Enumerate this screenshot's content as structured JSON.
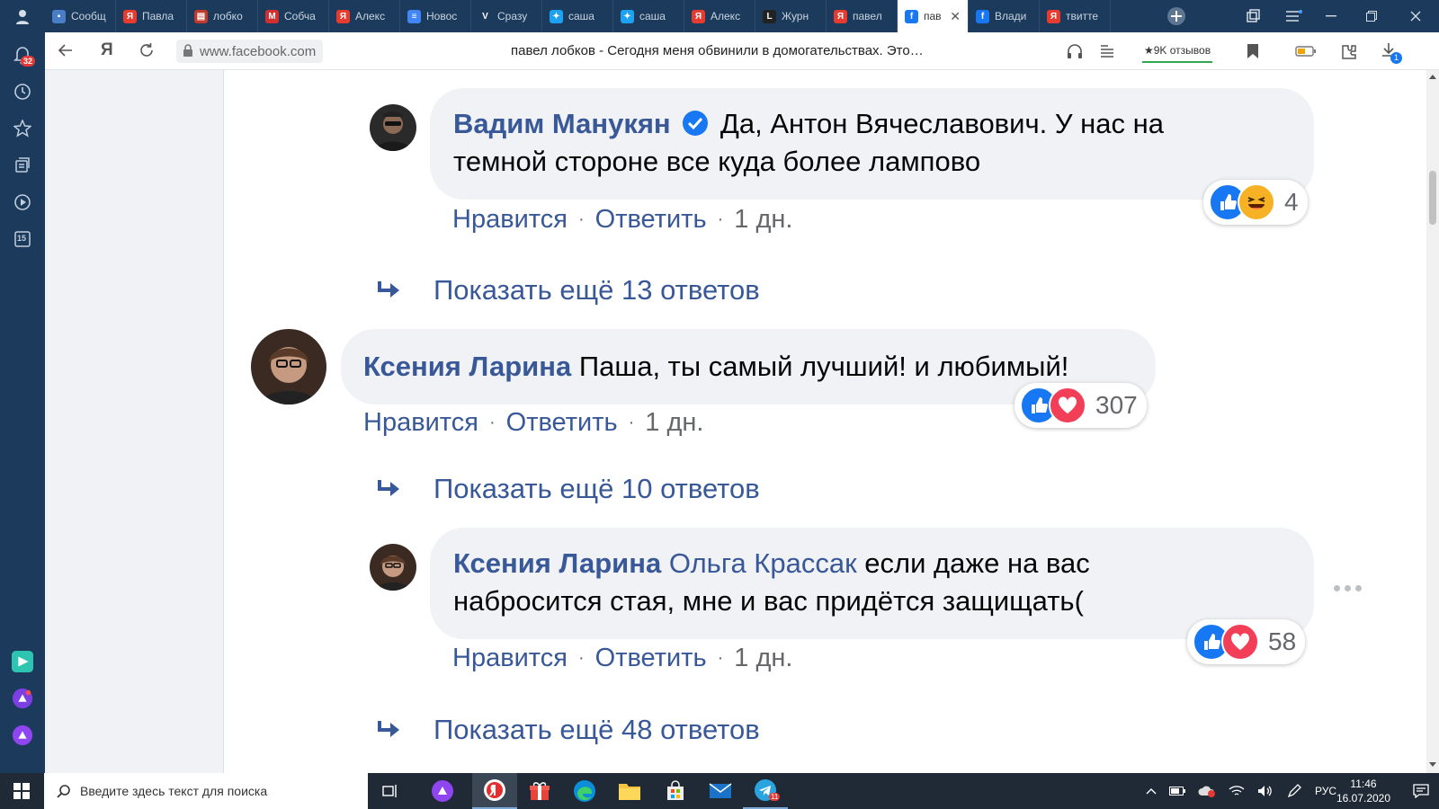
{
  "browser": {
    "tabs": [
      {
        "label": "Сообщ",
        "icon": "chat-icon",
        "color": "#4a7dc8"
      },
      {
        "label": "Павла",
        "icon": "yandex-icon",
        "color": "#e63b2e"
      },
      {
        "label": "лобко",
        "icon": "news-icon",
        "color": "#c0392b"
      },
      {
        "label": "Собча",
        "icon": "mk-icon",
        "color": "#d32f2f"
      },
      {
        "label": "Алекс",
        "icon": "yandex-icon",
        "color": "#e63b2e"
      },
      {
        "label": "Новос",
        "icon": "docs-icon",
        "color": "#4285f4"
      },
      {
        "label": "Сразу",
        "icon": "v-icon",
        "color": "#1b3a5c"
      },
      {
        "label": "саша",
        "icon": "twitter-icon",
        "color": "#1da1f2"
      },
      {
        "label": "саша",
        "icon": "twitter-icon",
        "color": "#1da1f2"
      },
      {
        "label": "Алекс",
        "icon": "yandex-icon",
        "color": "#e63b2e"
      },
      {
        "label": "Журн",
        "icon": "l-icon",
        "color": "#222222"
      },
      {
        "label": "павел",
        "icon": "yandex-icon",
        "color": "#e63b2e"
      },
      {
        "label": "пав",
        "icon": "facebook-icon",
        "color": "#1877f2",
        "active": true
      },
      {
        "label": "Влади",
        "icon": "facebook-icon",
        "color": "#1877f2"
      },
      {
        "label": "твитте",
        "icon": "yandex-icon",
        "color": "#e63b2e"
      }
    ],
    "address": "www.facebook.com",
    "page_title": "павел лобков - Сегодня меня обвинили в домогательствах. Это…",
    "reviews_label": "★9K отзывов",
    "notification_count": "32",
    "sidebar_badge": "15",
    "download_badge": "1"
  },
  "comments": {
    "c1": {
      "author": "Вадим Манукян",
      "text_line1": "Да, Антон Вячеславович. У нас на",
      "text_line2": "темной стороне все куда более лампово",
      "like": "Нравится",
      "reply": "Ответить",
      "time": "1 дн.",
      "reactions_count": "4"
    },
    "more1": "Показать ещё 13 ответов",
    "c2": {
      "author": "Ксения Ларина",
      "text": "Паша, ты самый лучший! и любимый!",
      "like": "Нравится",
      "reply": "Ответить",
      "time": "1 дн.",
      "reactions_count": "307"
    },
    "more2": "Показать ещё 10 ответов",
    "c3": {
      "author": "Ксения Ларина",
      "mention": "Ольга Крассак",
      "text_line1": "если даже на вас",
      "text_line2": "набросится стая, мне и вас придётся защищать(",
      "like": "Нравится",
      "reply": "Ответить",
      "time": "1 дн.",
      "reactions_count": "58"
    },
    "more3": "Показать ещё 48 ответов"
  },
  "taskbar": {
    "search_placeholder": "Введите здесь текст для поиска",
    "language": "РУС",
    "time": "11:46",
    "date": "16.07.2020",
    "telegram_badge": "11"
  },
  "colors": {
    "link": "#385898",
    "like_blue": "#1877f2",
    "love_red": "#f33e58",
    "haha_yellow": "#f7b125"
  }
}
